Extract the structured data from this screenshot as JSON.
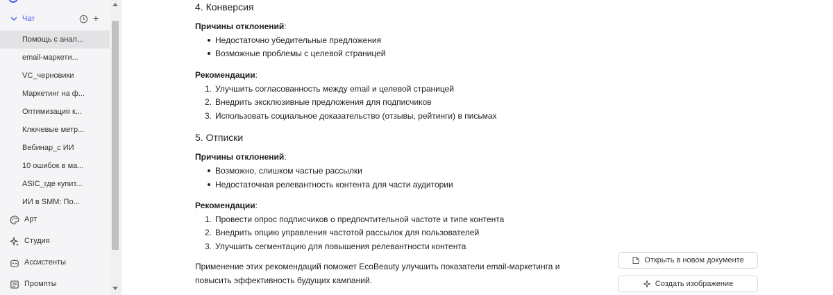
{
  "sidebar": {
    "chat_title": "Чат",
    "chats": [
      "Помощь с анал...",
      "email-маркети...",
      "VC_черновики",
      "Маркетинг на ф...",
      "Оптимизация к...",
      "Ключевые метр...",
      "Вебинар_с ИИ",
      "10 ошибок в ма...",
      "ASIC_где купит...",
      "ИИ в SMM: По..."
    ],
    "nav": {
      "art": "Арт",
      "studio": "Студия",
      "assistants": "Ассистенты",
      "prompts": "Промпты"
    }
  },
  "content": {
    "s4_title": "4. Конверсия",
    "s4_reasons_label": "Причины отклонений",
    "s4_reasons": [
      "Недостаточно убедительные предложения",
      "Возможные проблемы с целевой страницей"
    ],
    "s4_recs_label": "Рекомендации",
    "s4_recs": [
      "Улучшить согласованность между email и целевой страницей",
      "Внедрить эксклюзивные предложения для подписчиков",
      "Использовать социальное доказательство (отзывы, рейтинги) в письмах"
    ],
    "s5_title": "5. Отписки",
    "s5_reasons_label": "Причины отклонений",
    "s5_reasons": [
      "Возможно, слишком частые рассылки",
      "Недостаточная релевантность контента для части аудитории"
    ],
    "s5_recs_label": "Рекомендации",
    "s5_recs": [
      "Провести опрос подписчиков о предпочтительной частоте и типе контента",
      "Внедрить опцию управления частотой рассылок для пользователей",
      "Улучшить сегментацию для повышения релевантности контента"
    ],
    "closing_line1": "Применение этих рекомендаций поможет EcoBeauty улучшить показатели email-маркетинга и",
    "closing_line2": "повысить эффективность будущих кампаний."
  },
  "actions": {
    "open_new_doc": "Открыть в новом документе",
    "create_image": "Создать изображение"
  },
  "colors": {
    "accent": "#4a5ee8",
    "sidebar_bg": "#f5f5f7",
    "active_item": "#e3e3e6"
  }
}
